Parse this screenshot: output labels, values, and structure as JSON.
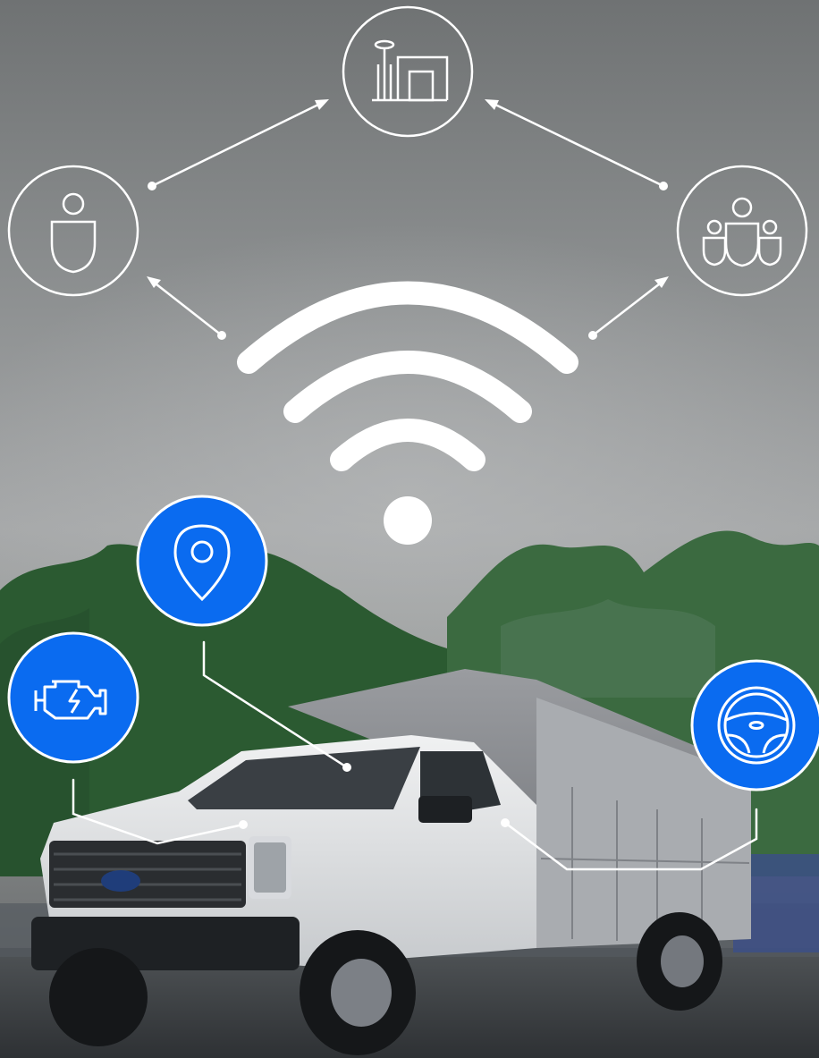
{
  "scene": {
    "description_free": true,
    "hub_icons": [
      {
        "name": "driver-icon",
        "style": "outline"
      },
      {
        "name": "facility-icon",
        "style": "outline"
      },
      {
        "name": "team-icon",
        "style": "outline"
      }
    ],
    "vehicle_icons": [
      {
        "name": "location-pin-icon",
        "style": "filled"
      },
      {
        "name": "engine-icon",
        "style": "filled"
      },
      {
        "name": "steering-wheel-icon",
        "style": "filled"
      }
    ],
    "signal_icon": "wifi-icon",
    "colors": {
      "accent_blue": "#0a6bf0",
      "line_white": "#ffffff",
      "sky_top": "#7d7f80",
      "sky_mid": "#a5a7a8",
      "tree_green": "#2f6b3a",
      "truck_white": "#e6e8ea",
      "truck_box_gray": "#8c8e92"
    }
  }
}
